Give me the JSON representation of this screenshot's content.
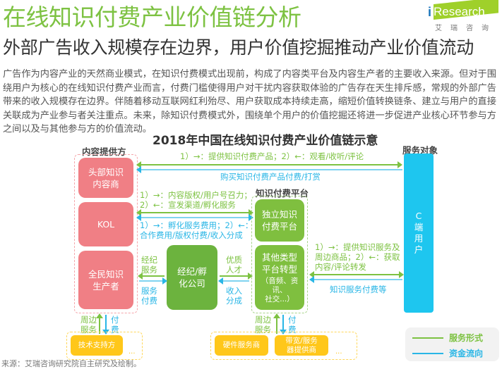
{
  "header": {
    "title": "在线知识付费产业价值链分析",
    "subtitle": "外部广告收入规模存在边界，用户价值挖掘推动产业价值流动",
    "logo": {
      "mark": "i",
      "brand": "Research",
      "cn": "艾瑞咨询",
      "color": "#9fd02a"
    }
  },
  "intro": "广告作为内容产业的天然商业模式，在知识付费模式出现前，构成了内容类平台及内容生产者的主要收入来源。但对于围绕用户为核心的在线知识付费产业而言，付费门槛使得用户对干扰内容获取体验的广告存在天生排斥感，常规的外部广告带来的收入规模存在边界。伴随着移动互联网红利殆尽、用户获取成本持续走高，缩短价值转换链条、建立与用户的直接关联成为产业参与者关注重点。未来，除知识付费模式外，围绕单个用户的价值挖掘还将进一步促进产业核心环节参与方之间以及与其他参与方的价值流动。",
  "diagram": {
    "title": "2018年中国在线知识付费产业价值链示意",
    "content_providers": {
      "label": "内容提供方",
      "items": [
        "头部知识\n内容商",
        "KOL",
        "全民知识\n生产者"
      ]
    },
    "platform": {
      "label": "知识付费平台",
      "items": [
        "独立知识\n付费平台",
        "其他类型\n平台转型"
      ],
      "note": "（音频、资讯、\n社交...）"
    },
    "agency": "经纪/孵\n化公司",
    "service_target": {
      "label": "服务对象",
      "block": "C\n端\n用\n户"
    },
    "flows": {
      "top_service": "1）→：提供知识付费产品；2）←：观看/收听/评论",
      "top_fund": "购买知识付费产品付费/打赏",
      "mid_service": "1）→：内容版权/用户号召力；\n2）←：宣发渠道/孵化服务",
      "mid_fund": "1）→：孵化服务费用；2）←：\n合作费用/版权付费/收入分成",
      "agency_left_service": "经纪\n服务",
      "agency_left_fund": "服务\n付费",
      "agency_right_service": "优质\n人才",
      "agency_right_fund": "收入\n分成",
      "right_service": "1）→：提供知识服务及\n周边商品；2）←：获取\n内容/评论转发",
      "right_fund": "知识服务付费等",
      "bottom_left_service": "周边\n服务",
      "bottom_left_fund": "付\n费",
      "bottom_mid_service": "周边\n服务",
      "bottom_mid_fund": "付\n费"
    },
    "support": {
      "left": [
        "技术支持方"
      ],
      "right": [
        "硬件服务商",
        "带宽/服务\n器提供商"
      ],
      "ellipsis": "..."
    },
    "legend": [
      {
        "label": "服务形式",
        "color": "#7dc242"
      },
      {
        "label": "资金流向",
        "color": "#29b6e6"
      }
    ]
  },
  "source": "来源：艾瑞咨询研究院自主研究及绘制。"
}
